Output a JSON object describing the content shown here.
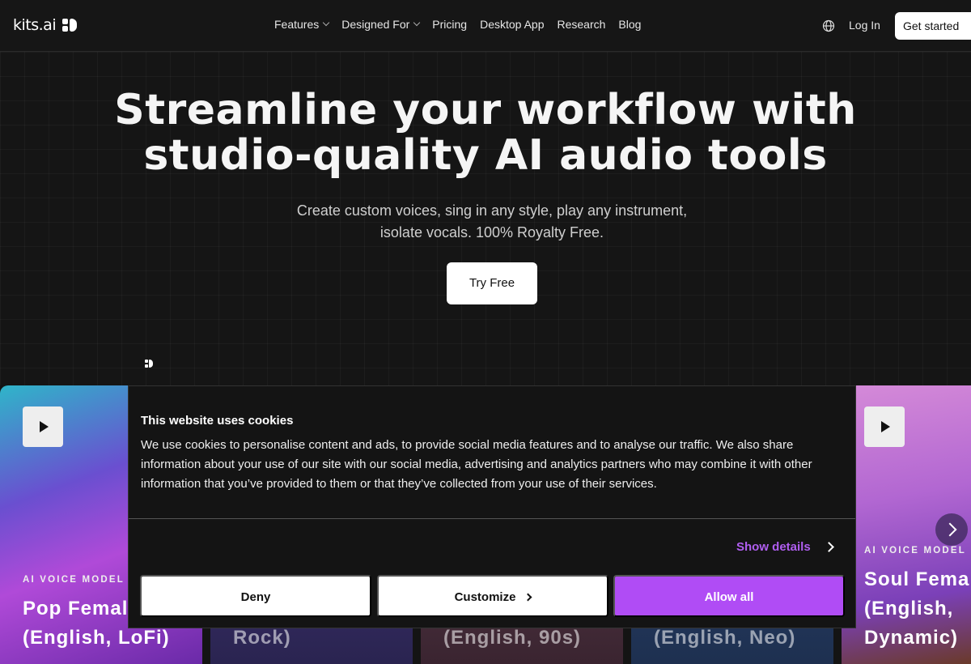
{
  "nav": {
    "logo_text": "kits.ai",
    "links": [
      {
        "label": "Features",
        "has_dropdown": true
      },
      {
        "label": "Designed For",
        "has_dropdown": true
      },
      {
        "label": "Pricing",
        "has_dropdown": false
      },
      {
        "label": "Desktop App",
        "has_dropdown": false
      },
      {
        "label": "Research",
        "has_dropdown": false
      },
      {
        "label": "Blog",
        "has_dropdown": false
      }
    ],
    "language_icon": "globe-icon",
    "login_label": "Log In",
    "cta_label": "Get started"
  },
  "hero": {
    "title_line1": "Streamline your workflow with",
    "title_line2": "studio-quality AI audio tools",
    "subtitle_line1": "Create custom voices, sing in any style, play any instrument,",
    "subtitle_line2": "isolate vocals. 100% Royalty Free.",
    "cta_label": "Try Free"
  },
  "cards": [
    {
      "tag": "AI VOICE MODEL",
      "name_line1": "Pop Female",
      "name_line2": "(English, LoFi)"
    },
    {
      "tag": "",
      "name_line1": "",
      "name_line2": "Rock)"
    },
    {
      "tag": "",
      "name_line1": "",
      "name_line2": "(English, 90s)"
    },
    {
      "tag": "",
      "name_line1": "",
      "name_line2": "(English, Neo)"
    },
    {
      "tag": "AI VOICE MODEL",
      "name_line1": "Soul Female",
      "name_line2": "(English,",
      "name_line3": "Dynamic)"
    }
  ],
  "cookie_banner": {
    "title": "This website uses cookies",
    "body": "We use cookies to personalise content and ads, to provide social media features and to analyse our traffic. We also share information about your use of our site with our social media, advertising and analytics partners who may combine it with other information that you’ve provided to them or that they’ve collected from your use of their services.",
    "show_details_label": "Show details",
    "deny_label": "Deny",
    "customize_label": "Customize",
    "allow_label": "Allow all"
  },
  "colors": {
    "accent": "#b04cf5",
    "background": "#141414"
  }
}
